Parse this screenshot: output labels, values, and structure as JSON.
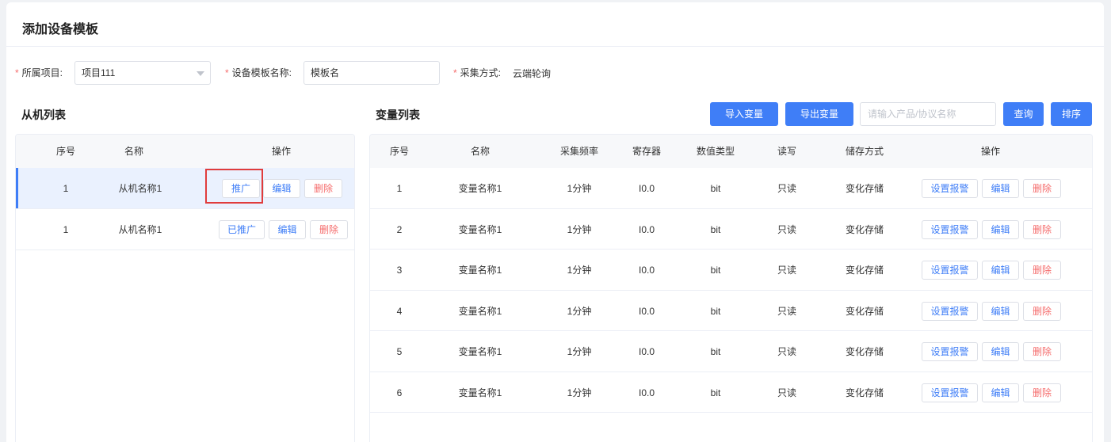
{
  "page": {
    "title": "添加设备模板"
  },
  "form": {
    "project_label": "所属项目:",
    "project_value": "项目111",
    "template_name_label": "设备模板名称:",
    "template_name_value": "模板名",
    "collect_method_label": "采集方式:",
    "collect_method_value": "云端轮询",
    "required_mark": "*"
  },
  "slave_list": {
    "title": "从机列表",
    "columns": [
      "序号",
      "名称",
      "操作"
    ],
    "rows": [
      {
        "index": "1",
        "name": "从机名称1",
        "push_label": "推广",
        "edit_label": "编辑",
        "delete_label": "删除"
      },
      {
        "index": "1",
        "name": "从机名称1",
        "push_label": "已推广",
        "edit_label": "编辑",
        "delete_label": "删除"
      }
    ]
  },
  "variable_list": {
    "title": "变量列表",
    "toolbar": {
      "import_label": "导入变量",
      "export_label": "导出变量",
      "search_placeholder": "请输入产品/协议名称",
      "query_label": "查询",
      "sort_label": "排序"
    },
    "columns": [
      "序号",
      "名称",
      "采集频率",
      "寄存器",
      "数值类型",
      "读写",
      "储存方式",
      "操作"
    ],
    "actions": {
      "alarm_label": "设置报警",
      "edit_label": "编辑",
      "delete_label": "删除"
    },
    "rows": [
      {
        "index": "1",
        "name": "变量名称1",
        "freq": "1分钟",
        "register": "I0.0",
        "type": "bit",
        "rw": "只读",
        "storage": "变化存储"
      },
      {
        "index": "2",
        "name": "变量名称1",
        "freq": "1分钟",
        "register": "I0.0",
        "type": "bit",
        "rw": "只读",
        "storage": "变化存储"
      },
      {
        "index": "3",
        "name": "变量名称1",
        "freq": "1分钟",
        "register": "I0.0",
        "type": "bit",
        "rw": "只读",
        "storage": "变化存储"
      },
      {
        "index": "4",
        "name": "变量名称1",
        "freq": "1分钟",
        "register": "I0.0",
        "type": "bit",
        "rw": "只读",
        "storage": "变化存储"
      },
      {
        "index": "5",
        "name": "变量名称1",
        "freq": "1分钟",
        "register": "I0.0",
        "type": "bit",
        "rw": "只读",
        "storage": "变化存储"
      },
      {
        "index": "6",
        "name": "变量名称1",
        "freq": "1分钟",
        "register": "I0.0",
        "type": "bit",
        "rw": "只读",
        "storage": "变化存储"
      }
    ]
  },
  "colors": {
    "primary": "#3f7ef7",
    "danger": "#f56c6c",
    "highlight": "#e03c3c",
    "selected_row": "#eaf1fe"
  }
}
